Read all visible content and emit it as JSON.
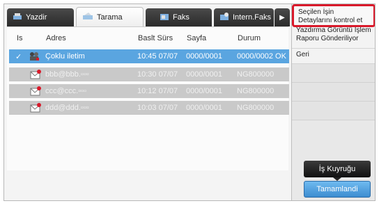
{
  "tabs": [
    {
      "label": "Yazdir",
      "icon": "printer-icon"
    },
    {
      "label": "Tarama",
      "icon": "scanner-icon"
    },
    {
      "label": "Faks",
      "icon": "fax-icon"
    },
    {
      "label": "Intern.Faks",
      "icon": "internet-fax-icon"
    }
  ],
  "columns": {
    "is": "Is",
    "address": "Adres",
    "start": "Baslt Sürs",
    "page": "Sayfa",
    "status": "Durum"
  },
  "rows": [
    {
      "address": "Çoklu iletim",
      "start": "10:45 07/07",
      "page": "0000/0001",
      "status": "0000/0002 OK",
      "icon": "group-send-icon",
      "selected": true
    },
    {
      "address": "bbb@bbb.▫▫▫",
      "start": "10:30 07/07",
      "page": "0000/0001",
      "status": "NG800000",
      "icon": "email-error-icon"
    },
    {
      "address": "ccc@ccc.▫▫▫",
      "start": "10:12 07/07",
      "page": "0000/0001",
      "status": "NG800000",
      "icon": "email-error-icon"
    },
    {
      "address": "ddd@ddd.▫▫▫",
      "start": "10:03 07/07",
      "page": "0000/0001",
      "status": "NG800000",
      "icon": "email-error-icon"
    }
  ],
  "menu": {
    "item1": "Seçilen İşin Detaylarını kontrol et",
    "item2": "Yazdırma Görüntü İşlem Raporu Gönderiliyor",
    "item3": "Geri"
  },
  "buttons": {
    "queue": "İş Kuyruğu",
    "done": "Tamamlandi"
  },
  "colors": {
    "selected_row": "#5aa5e0",
    "highlight_border": "#d9192a",
    "done_button": "#4f9fe0"
  }
}
